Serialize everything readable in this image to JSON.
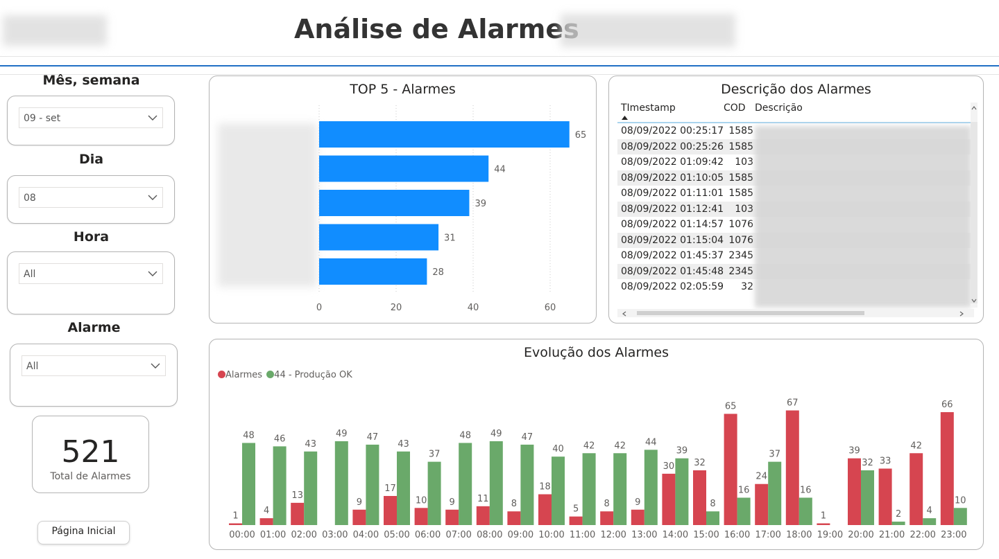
{
  "header": {
    "title": "Análise de Alarmes"
  },
  "slicers": [
    {
      "label": "Mês, semana",
      "value": "09 - set"
    },
    {
      "label": "Dia",
      "value": "08"
    },
    {
      "label": "Hora",
      "value": "All"
    },
    {
      "label": "Alarme",
      "value": "All"
    }
  ],
  "kpi": {
    "value": "521",
    "label": "Total de Alarmes"
  },
  "home_button": "Página Inicial",
  "top5": {
    "title": "TOP 5 - Alarmes",
    "colors": {
      "bar": "#118dff"
    },
    "chart_data": {
      "type": "bar",
      "orientation": "horizontal",
      "values": [
        65,
        44,
        39,
        31,
        28
      ],
      "xlim": [
        0,
        65
      ],
      "xticks": [
        "0",
        "20",
        "40",
        "60"
      ]
    }
  },
  "table": {
    "title": "Descrição dos Alarmes",
    "columns": [
      "TImestamp",
      "COD",
      "Descrição"
    ],
    "rows": [
      {
        "ts": "08/09/2022 00:25:17",
        "cod": "1585"
      },
      {
        "ts": "08/09/2022 00:25:26",
        "cod": "1585"
      },
      {
        "ts": "08/09/2022 01:09:42",
        "cod": "103"
      },
      {
        "ts": "08/09/2022 01:10:05",
        "cod": "1585"
      },
      {
        "ts": "08/09/2022 01:11:01",
        "cod": "1585"
      },
      {
        "ts": "08/09/2022 01:12:41",
        "cod": "103"
      },
      {
        "ts": "08/09/2022 01:14:57",
        "cod": "1076"
      },
      {
        "ts": "08/09/2022 01:15:04",
        "cod": "1076"
      },
      {
        "ts": "08/09/2022 01:45:37",
        "cod": "2345"
      },
      {
        "ts": "08/09/2022 01:45:48",
        "cod": "2345"
      },
      {
        "ts": "08/09/2022 02:05:59",
        "cod": "32"
      }
    ]
  },
  "evolution": {
    "title": "Evolução dos Alarmes",
    "colors": {
      "alarmes": "#d64550",
      "producao": "#6aa96a"
    },
    "chart_data": {
      "type": "bar",
      "categories": [
        "00:00",
        "01:00",
        "02:00",
        "03:00",
        "04:00",
        "05:00",
        "06:00",
        "07:00",
        "08:00",
        "09:00",
        "10:00",
        "11:00",
        "12:00",
        "13:00",
        "14:00",
        "15:00",
        "16:00",
        "17:00",
        "18:00",
        "19:00",
        "20:00",
        "21:00",
        "22:00",
        "23:00"
      ],
      "series": [
        {
          "name": "Alarmes",
          "values": [
            1,
            4,
            13,
            null,
            9,
            17,
            10,
            9,
            11,
            8,
            18,
            5,
            8,
            9,
            30,
            32,
            65,
            24,
            67,
            1,
            39,
            33,
            42,
            66
          ]
        },
        {
          "name": "44 - Produção OK",
          "values": [
            48,
            46,
            43,
            49,
            47,
            43,
            37,
            48,
            49,
            47,
            40,
            42,
            42,
            44,
            39,
            8,
            16,
            37,
            16,
            null,
            32,
            2,
            4,
            10
          ]
        }
      ],
      "ylim": [
        0,
        70
      ]
    }
  }
}
